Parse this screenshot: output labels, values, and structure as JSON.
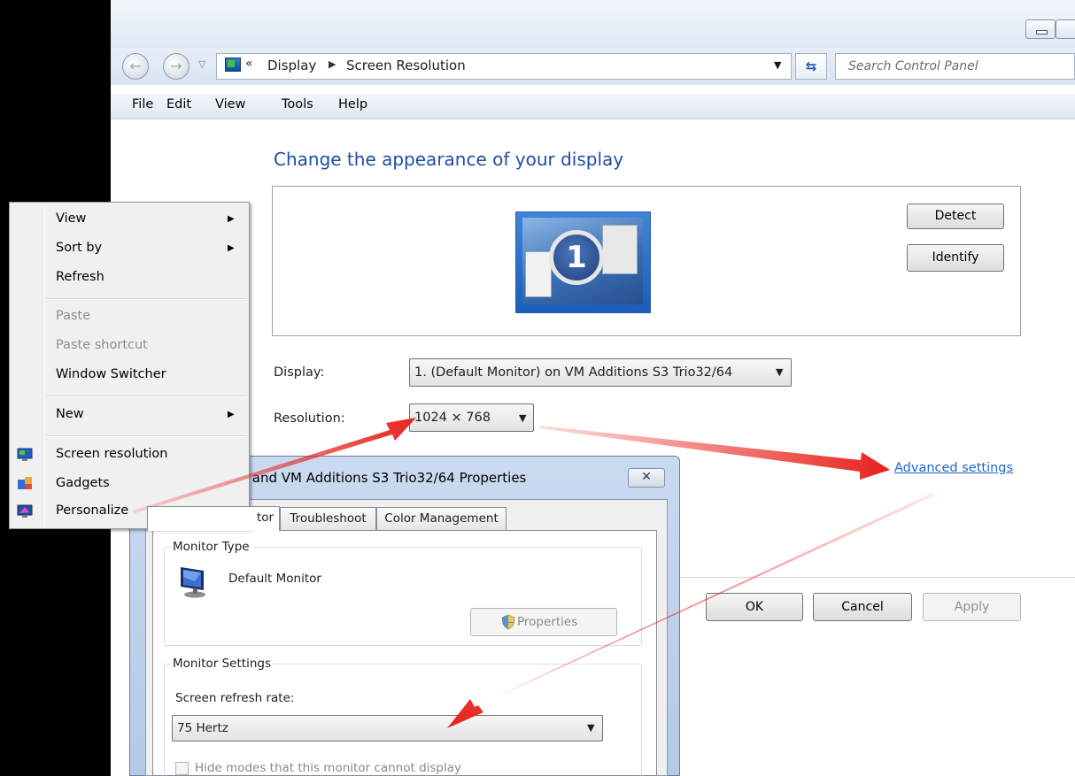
{
  "window": {
    "address": {
      "crumb1": "Display",
      "crumb2": "Screen Resolution",
      "chevrons": "«"
    },
    "search": {
      "placeholder": "Search Control Panel"
    },
    "menu": [
      "File",
      "Edit",
      "View",
      "Tools",
      "Help"
    ]
  },
  "main": {
    "title": "Change the appearance of your display",
    "monitor_number": "1",
    "detect_label": "Detect",
    "identify_label": "Identify",
    "display_label": "Display:",
    "display_value": "1. (Default Monitor) on VM Additions S3 Trio32/64",
    "resolution_label": "Resolution:",
    "resolution_value": "1024 × 768",
    "advanced_link": "Advanced settings",
    "ok_label": "OK",
    "cancel_label": "Cancel",
    "apply_label": "Apply"
  },
  "dialog": {
    "title": "r) and VM Additions S3 Trio32/64 Properties",
    "close_label": "✕",
    "tabs": [
      "tor",
      "Troubleshoot",
      "Color Management"
    ],
    "monitor_type_group": "Monitor Type",
    "monitor_name": "Default Monitor",
    "properties_label": "Properties",
    "monitor_settings_group": "Monitor Settings",
    "refresh_rate_label": "Screen refresh rate:",
    "refresh_rate_value": "75 Hertz",
    "hide_modes_label": "Hide modes that this monitor cannot display"
  },
  "context_menu": {
    "items": [
      {
        "label": "View",
        "submenu": true,
        "enabled": true
      },
      {
        "label": "Sort by",
        "submenu": true,
        "enabled": true
      },
      {
        "label": "Refresh",
        "submenu": false,
        "enabled": true
      },
      {
        "label": "Paste",
        "submenu": false,
        "enabled": false
      },
      {
        "label": "Paste shortcut",
        "submenu": false,
        "enabled": false
      },
      {
        "label": "Window Switcher",
        "submenu": false,
        "enabled": true
      },
      {
        "label": "New",
        "submenu": true,
        "enabled": true
      },
      {
        "label": "Screen resolution",
        "submenu": false,
        "enabled": true,
        "icon": "screen-resolution-icon"
      },
      {
        "label": "Gadgets",
        "submenu": false,
        "enabled": true,
        "icon": "gadgets-icon"
      },
      {
        "label": "Personalize",
        "submenu": false,
        "enabled": true,
        "icon": "personalize-icon"
      }
    ]
  },
  "colors": {
    "title_blue": "#1e4ea1",
    "link_blue": "#1f66cc",
    "annotation_arrow": "#e8221d"
  }
}
